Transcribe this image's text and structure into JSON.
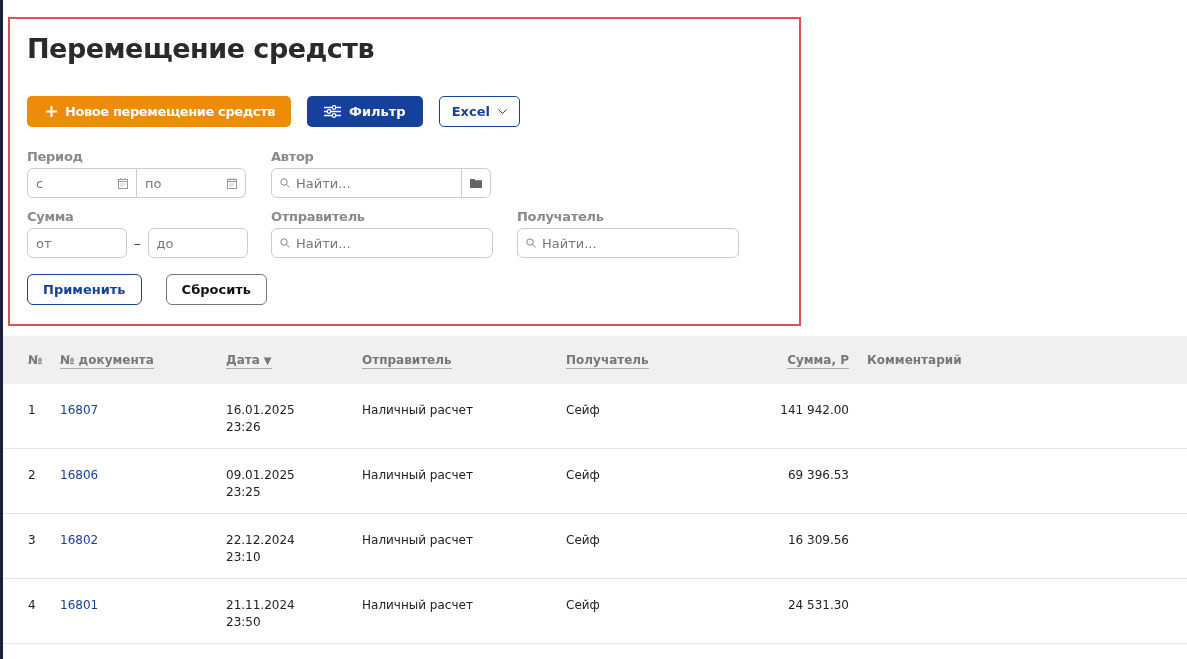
{
  "title": "Перемещение средств",
  "actions": [
    {
      "kind": "primary",
      "label": "Новое перемещение средств"
    },
    {
      "kind": "filter",
      "label": "Фильтр"
    },
    {
      "kind": "dropdown",
      "label": "Excel"
    }
  ],
  "filters": {
    "period": {
      "label": "Период",
      "from": "с",
      "to": "по"
    },
    "author": {
      "label": "Автор",
      "placeholder": "Найти..."
    },
    "amount": {
      "label": "Сумма",
      "from": "от",
      "separator": "–",
      "to": "до"
    },
    "sender": {
      "label": "Отправитель",
      "placeholder": "Найти..."
    },
    "recipient": {
      "label": "Получатель",
      "placeholder": "Найти..."
    },
    "buttons": [
      {
        "kind": "apply",
        "label": "Применить"
      },
      {
        "kind": "reset",
        "label": "Сбросить"
      }
    ]
  },
  "table": {
    "columns": [
      {
        "label": "№",
        "sortable": false
      },
      {
        "label": "№ документа",
        "sortable": true
      },
      {
        "label": "Дата",
        "sortable": true,
        "sort_arrow": "▼"
      },
      {
        "label": "Отправитель",
        "sortable": true
      },
      {
        "label": "Получатель",
        "sortable": true
      },
      {
        "label": "Сумма, Р",
        "sortable": true
      },
      {
        "label": "Комментарий",
        "sortable": false
      }
    ],
    "rows": [
      {
        "n": "1",
        "doc": "16807",
        "date": "16.01.2025",
        "time": "23:26",
        "sender": "Наличный расчет",
        "recipient": "Сейф",
        "sum": "141 942.00"
      },
      {
        "n": "2",
        "doc": "16806",
        "date": "09.01.2025",
        "time": "23:25",
        "sender": "Наличный расчет",
        "recipient": "Сейф",
        "sum": "69 396.53"
      },
      {
        "n": "3",
        "doc": "16802",
        "date": "22.12.2024",
        "time": "23:10",
        "sender": "Наличный расчет",
        "recipient": "Сейф",
        "sum": "16 309.56"
      },
      {
        "n": "4",
        "doc": "16801",
        "date": "21.11.2024",
        "time": "23:50",
        "sender": "Наличный расчет",
        "recipient": "Сейф",
        "sum": "24 531.30"
      }
    ]
  }
}
